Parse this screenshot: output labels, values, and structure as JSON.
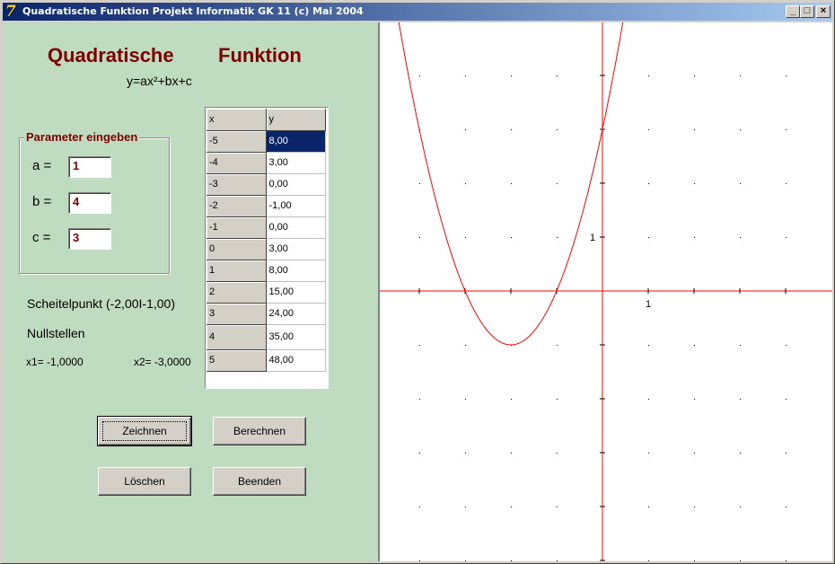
{
  "window": {
    "title": "Quadratische Funktion Projekt Informatik GK 11 (c) Mai 2004",
    "icon": "7",
    "controls": {
      "minimize": "_",
      "maximize": "□",
      "close": "×"
    }
  },
  "header": {
    "word1": "Quadratische",
    "word2": "Funktion",
    "formula": "y=ax²+bx+c"
  },
  "parameters": {
    "legend": "Parameter eingeben",
    "a_label": "a =",
    "a_value": "1",
    "b_label": "b =",
    "b_value": "4",
    "c_label": "c =",
    "c_value": "3"
  },
  "results": {
    "vertex": "Scheitelpunkt (-2,00I-1,00)",
    "zeros_label": "Nullstellen",
    "x1": "x1= -1,0000",
    "x2": "x2= -3,0000"
  },
  "table": {
    "headers": [
      "x",
      "y"
    ],
    "rows": [
      [
        "-5",
        "8,00"
      ],
      [
        "-4",
        "3,00"
      ],
      [
        "-3",
        "0,00"
      ],
      [
        "-2",
        "-1,00"
      ],
      [
        "-1",
        "0,00"
      ],
      [
        "0",
        "3,00"
      ],
      [
        "1",
        "8,00"
      ],
      [
        "2",
        "15,00"
      ],
      [
        "3",
        "24,00"
      ],
      [
        "4",
        "35,00"
      ],
      [
        "5",
        "48,00"
      ]
    ],
    "selected_row": 0
  },
  "buttons": {
    "draw": "Zeichnen",
    "compute": "Berechnen",
    "clear": "Löschen",
    "exit": "Beenden"
  },
  "graph": {
    "x_tick_label": "1",
    "y_tick_label": "1",
    "curve_color": "#ff0000",
    "axis_color": "#ff0000",
    "function": {
      "a": 1,
      "b": 4,
      "c": 3
    }
  }
}
